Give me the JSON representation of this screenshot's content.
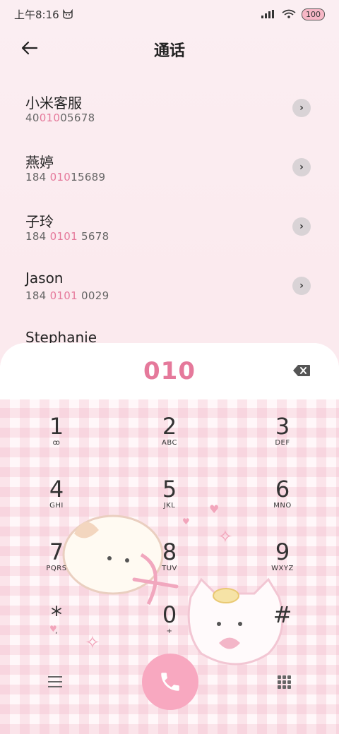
{
  "status": {
    "time": "上午8:16",
    "battery": "100"
  },
  "header": {
    "title": "通话"
  },
  "contacts": [
    {
      "name": "小米客服",
      "num_pre": "40",
      "num_hl": "010",
      "num_post": "05678"
    },
    {
      "name": "燕婷",
      "num_pre": "184 ",
      "num_hl": "010",
      "num_post": "15689"
    },
    {
      "name": "子玲",
      "num_pre": "184 ",
      "num_hl": "0101",
      "num_post": " 5678"
    },
    {
      "name": "Jason",
      "num_pre": "184 ",
      "num_hl": "0101",
      "num_post": " 0029"
    },
    {
      "name": "Stephanie",
      "num_pre": "",
      "num_hl": "",
      "num_post": ""
    }
  ],
  "dialer": {
    "input": "010",
    "keys": [
      {
        "digit": "1",
        "letters": "ꝏ"
      },
      {
        "digit": "2",
        "letters": "ABC"
      },
      {
        "digit": "3",
        "letters": "DEF"
      },
      {
        "digit": "4",
        "letters": "GHI"
      },
      {
        "digit": "5",
        "letters": "JKL"
      },
      {
        "digit": "6",
        "letters": "MNO"
      },
      {
        "digit": "7",
        "letters": "PQRS"
      },
      {
        "digit": "8",
        "letters": "TUV"
      },
      {
        "digit": "9",
        "letters": "WXYZ"
      },
      {
        "digit": "*",
        "letters": ","
      },
      {
        "digit": "0",
        "letters": "+"
      },
      {
        "digit": "#",
        "letters": ""
      }
    ]
  },
  "colors": {
    "accent": "#e5799b",
    "call_button": "#f8a8c0"
  },
  "icons": [
    "back-arrow-icon",
    "chevron-right-icon",
    "backspace-icon",
    "menu-icon",
    "phone-icon",
    "dialpad-icon"
  ]
}
